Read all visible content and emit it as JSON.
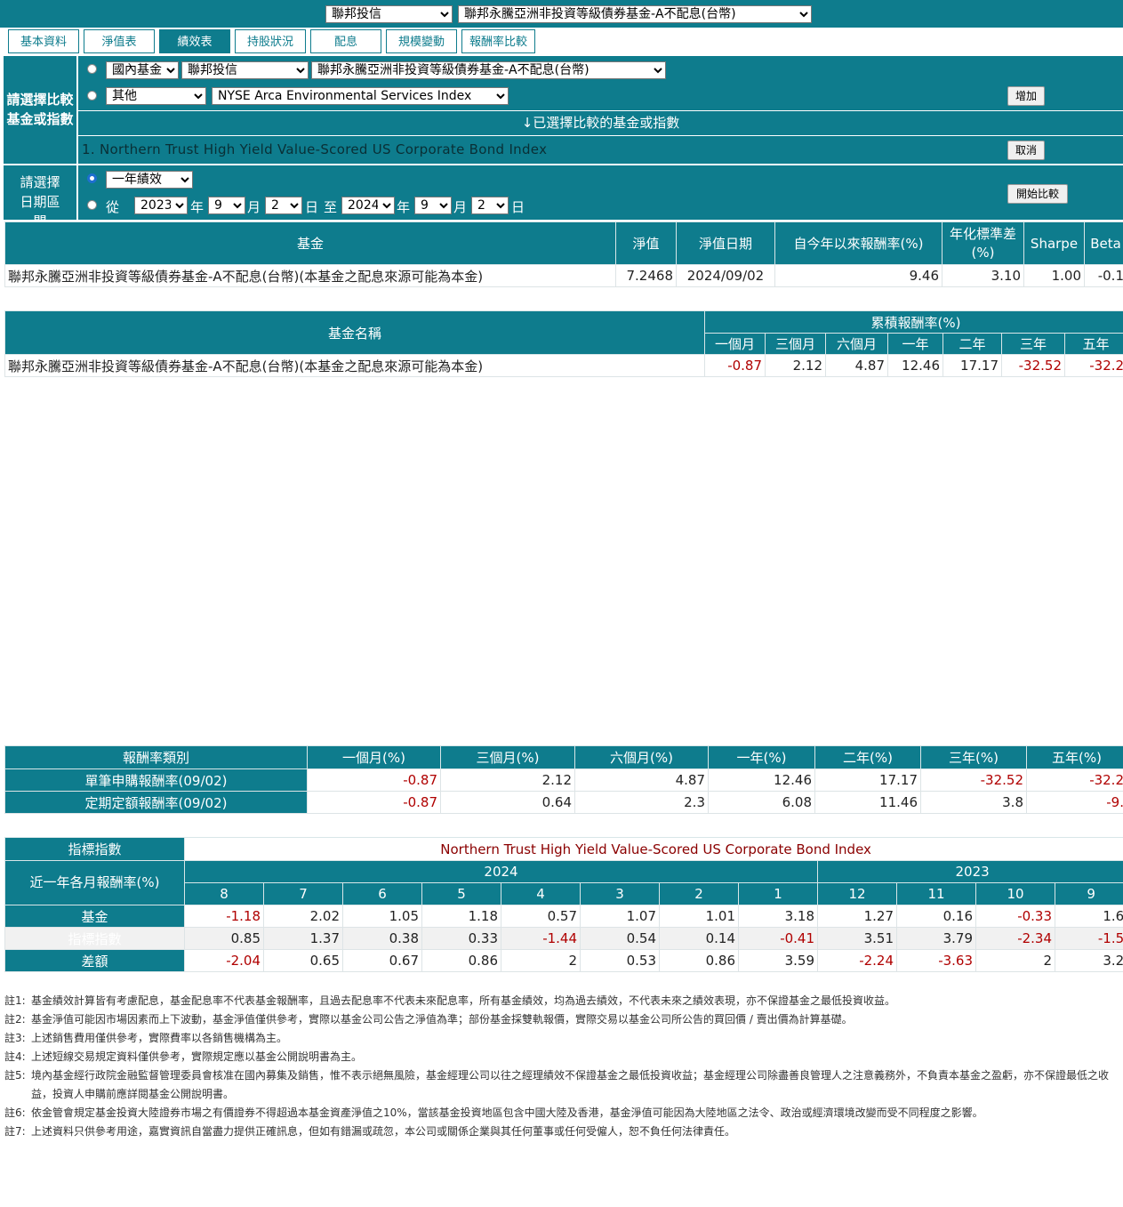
{
  "top": {
    "company": "聯邦投信",
    "fund": "聯邦永騰亞洲非投資等級債券基金-A不配息(台幣)"
  },
  "tabs": [
    "基本資料",
    "淨值表",
    "績效表",
    "持股狀況",
    "配息",
    "規模變動",
    "報酬率比較"
  ],
  "compare": {
    "label": "請選擇比較基金或指數",
    "row1": {
      "type": "國內基金",
      "company": "聯邦投信",
      "fund": "聯邦永騰亞洲非投資等級債券基金-A不配息(台幣)"
    },
    "row2": {
      "type": "其他",
      "index": "NYSE Arca Environmental Services Index"
    },
    "add_button": "增加",
    "selected_header": "↓已選擇比較的基金或指數",
    "selected_item": "1. Northern Trust High Yield Value-Scored US Corporate Bond Index",
    "cancel_button": "取消",
    "date_label": "請選擇日期區間",
    "period": "一年績效",
    "from_label": "從",
    "from": {
      "year": "2023",
      "month": "9",
      "day": "2"
    },
    "to_label": "至",
    "to": {
      "year": "2024",
      "month": "9",
      "day": "2"
    },
    "unit_year": "年",
    "unit_month": "月",
    "unit_day": "日",
    "start_button": "開始比較"
  },
  "summary": {
    "headers": [
      "基金",
      "淨值",
      "淨值日期",
      "自今年以來報酬率(%)",
      "年化標準差(%)",
      "Sharpe",
      "Beta"
    ],
    "row": [
      "聯邦永騰亞洲非投資等級債券基金-A不配息(台幣)(本基金之配息來源可能為本金)",
      "7.2468",
      "2024/09/02",
      "9.46",
      "3.10",
      "1.00",
      "-0.1"
    ]
  },
  "cumulative": {
    "name_header": "基金名稱",
    "group_header": "累積報酬率(%)",
    "periods": [
      "一個月",
      "三個月",
      "六個月",
      "一年",
      "二年",
      "三年",
      "五年"
    ],
    "fund": "聯邦永騰亞洲非投資等級債券基金-A不配息(台幣)(本基金之配息來源可能為本金)",
    "values": [
      "-0.87",
      "2.12",
      "4.87",
      "12.46",
      "17.17",
      "-32.52",
      "-32.2"
    ]
  },
  "returns": {
    "headers": [
      "報酬率類別",
      "一個月(%)",
      "三個月(%)",
      "六個月(%)",
      "一年(%)",
      "二年(%)",
      "三年(%)",
      "五年(%)"
    ],
    "rows": [
      {
        "label": "單筆申購報酬率(09/02)",
        "values": [
          "-0.87",
          "2.12",
          "4.87",
          "12.46",
          "17.17",
          "-32.52",
          "-32.2"
        ]
      },
      {
        "label": "定期定額報酬率(09/02)",
        "values": [
          "-0.87",
          "0.64",
          "2.3",
          "6.08",
          "11.46",
          "3.8",
          "-9."
        ]
      }
    ]
  },
  "monthly": {
    "index_header": "指標指數",
    "index_name": "Northern Trust High Yield Value-Scored US Corporate Bond Index",
    "row_header": "近一年各月報酬率(%)",
    "year1": "2024",
    "year2": "2023",
    "months": [
      "8",
      "7",
      "6",
      "5",
      "4",
      "3",
      "2",
      "1",
      "12",
      "11",
      "10",
      "9"
    ],
    "rows": [
      {
        "label": "基金",
        "values": [
          "-1.18",
          "2.02",
          "1.05",
          "1.18",
          "0.57",
          "1.07",
          "1.01",
          "3.18",
          "1.27",
          "0.16",
          "-0.33",
          "1.6"
        ]
      },
      {
        "label": "指標指數",
        "values": [
          "0.85",
          "1.37",
          "0.38",
          "0.33",
          "-1.44",
          "0.54",
          "0.14",
          "-0.41",
          "3.51",
          "3.79",
          "-2.34",
          "-1.5"
        ]
      },
      {
        "label": "差額",
        "values": [
          "-2.04",
          "0.65",
          "0.67",
          "0.86",
          "2",
          "0.53",
          "0.86",
          "3.59",
          "-2.24",
          "-3.63",
          "2",
          "3.2"
        ]
      }
    ]
  },
  "notes": [
    {
      "k": "註1:",
      "t": "基金績效計算皆有考慮配息，基金配息率不代表基金報酬率，且過去配息率不代表未來配息率，所有基金績效，均為過去績效，不代表未來之績效表現，亦不保證基金之最低投資收益。"
    },
    {
      "k": "註2:",
      "t": "基金淨值可能因市場因素而上下波動，基金淨值僅供參考，實際以基金公司公告之淨值為準；部份基金採雙軌報價，實際交易以基金公司所公告的買回價 / 賣出價為計算基礎。"
    },
    {
      "k": "註3:",
      "t": "上述銷售費用僅供參考，實際費率以各銷售機構為主。"
    },
    {
      "k": "註4:",
      "t": "上述短線交易規定資料僅供參考，實際規定應以基金公開說明書為主。"
    },
    {
      "k": "註5:",
      "t": "境內基金經行政院金融監督管理委員會核准在國內募集及銷售，惟不表示絕無風險，基金經理公司以往之經理績效不保證基金之最低投資收益；基金經理公司除盡善良管理人之注意義務外，不負責本基金之盈虧，亦不保證最低之收益，投資人申購前應詳閱基金公開說明書。"
    },
    {
      "k": "註6:",
      "t": "依金管會規定基金投資大陸證券市場之有價證券不得超過本基金資產淨值之10%，當該基金投資地區包含中國大陸及香港，基金淨值可能因為大陸地區之法令、政治或經濟環境改變而受不同程度之影響。"
    },
    {
      "k": "註7:",
      "t": "上述資料只供參考用途，嘉實資訊自當盡力提供正確訊息，但如有錯漏或疏忽，本公司或關係企業與其任何董事或任何受僱人，恕不負任何法律責任。"
    }
  ],
  "colors": {
    "teal": "#0e7c8d",
    "negative": "#b00000",
    "index_title": "#8b0000"
  }
}
